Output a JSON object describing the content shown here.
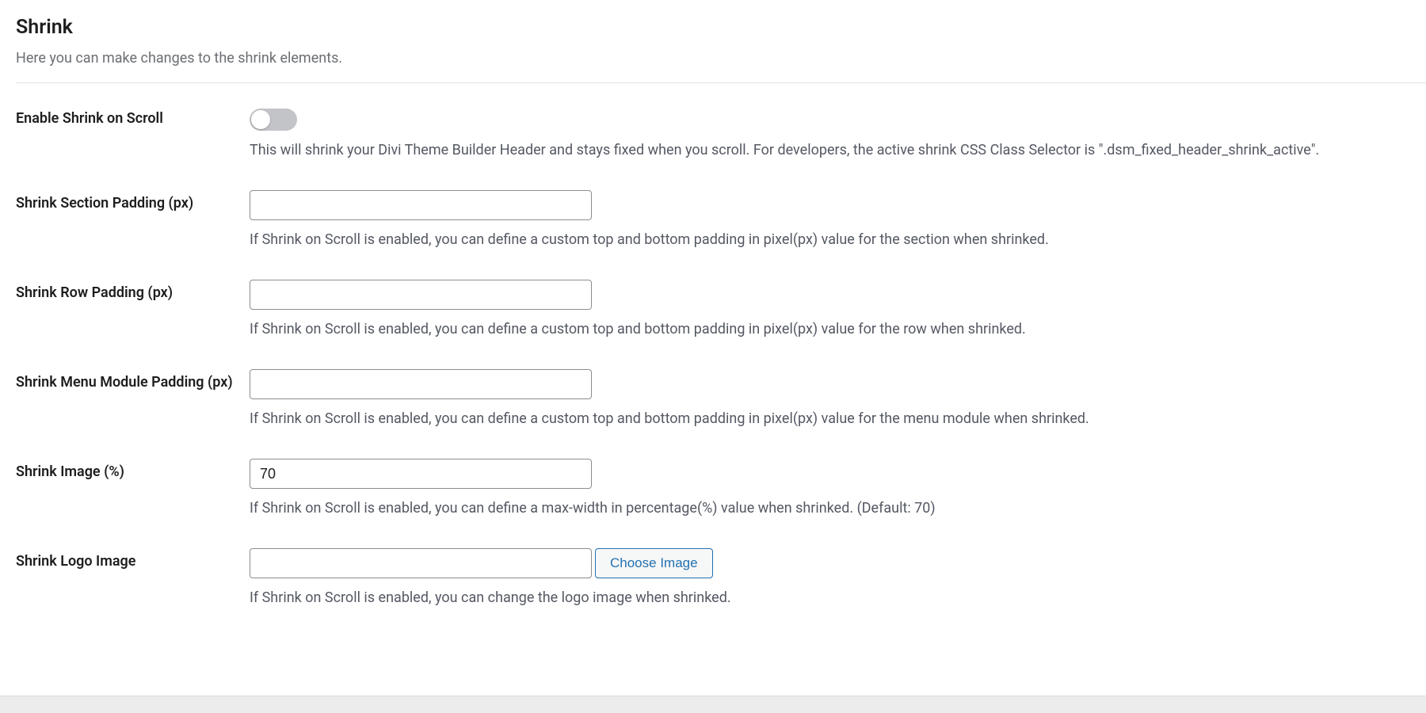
{
  "section": {
    "title": "Shrink",
    "subtitle": "Here you can make changes to the shrink elements."
  },
  "fields": {
    "enable_shrink": {
      "label": "Enable Shrink on Scroll",
      "checked": false,
      "desc": "This will shrink your Divi Theme Builder Header and stays fixed when you scroll. For developers, the active shrink CSS Class Selector is \".dsm_fixed_header_shrink_active\"."
    },
    "section_padding": {
      "label": "Shrink Section Padding (px)",
      "value": "",
      "desc": "If Shrink on Scroll is enabled, you can define a custom top and bottom padding in pixel(px) value for the section when shrinked."
    },
    "row_padding": {
      "label": "Shrink Row Padding (px)",
      "value": "",
      "desc": "If Shrink on Scroll is enabled, you can define a custom top and bottom padding in pixel(px) value for the row when shrinked."
    },
    "menu_padding": {
      "label": "Shrink Menu Module Padding (px)",
      "value": "",
      "desc": "If Shrink on Scroll is enabled, you can define a custom top and bottom padding in pixel(px) value for the menu module when shrinked."
    },
    "shrink_image": {
      "label": "Shrink Image (%)",
      "value": "70",
      "desc": "If Shrink on Scroll is enabled, you can define a max-width in percentage(%) value when shrinked. (Default: 70)"
    },
    "logo_image": {
      "label": "Shrink Logo Image",
      "value": "",
      "button": "Choose Image",
      "desc": "If Shrink on Scroll is enabled, you can change the logo image when shrinked."
    }
  }
}
